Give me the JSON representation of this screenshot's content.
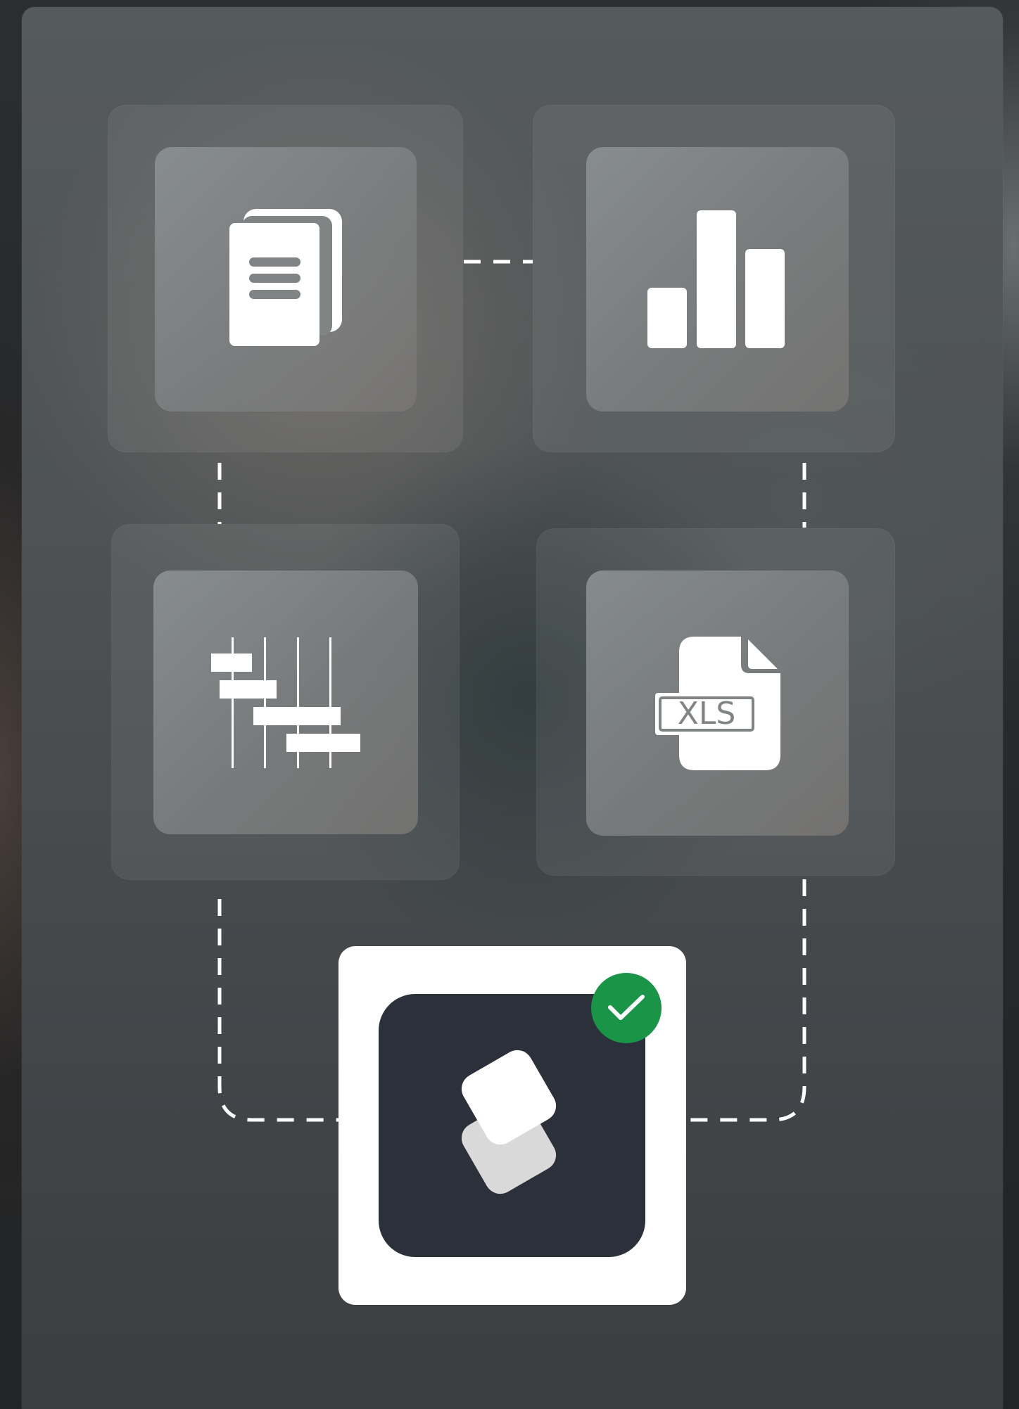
{
  "colors": {
    "panel_background": "#4d5153",
    "tile_background": "#808485",
    "icon_foreground": "#ffffff",
    "app_card_background": "#ffffff",
    "app_tile_background": "#2c303b",
    "success_badge": "#1a9446",
    "connector_line": "#ffffff"
  },
  "tiles": [
    {
      "icon": "documents-icon"
    },
    {
      "icon": "bar-chart-icon"
    },
    {
      "icon": "gantt-chart-icon"
    },
    {
      "icon": "xls-file-icon",
      "badge_text": "XLS"
    }
  ],
  "app": {
    "icon": "stacked-squares-logo-icon",
    "status_icon": "check-icon"
  }
}
